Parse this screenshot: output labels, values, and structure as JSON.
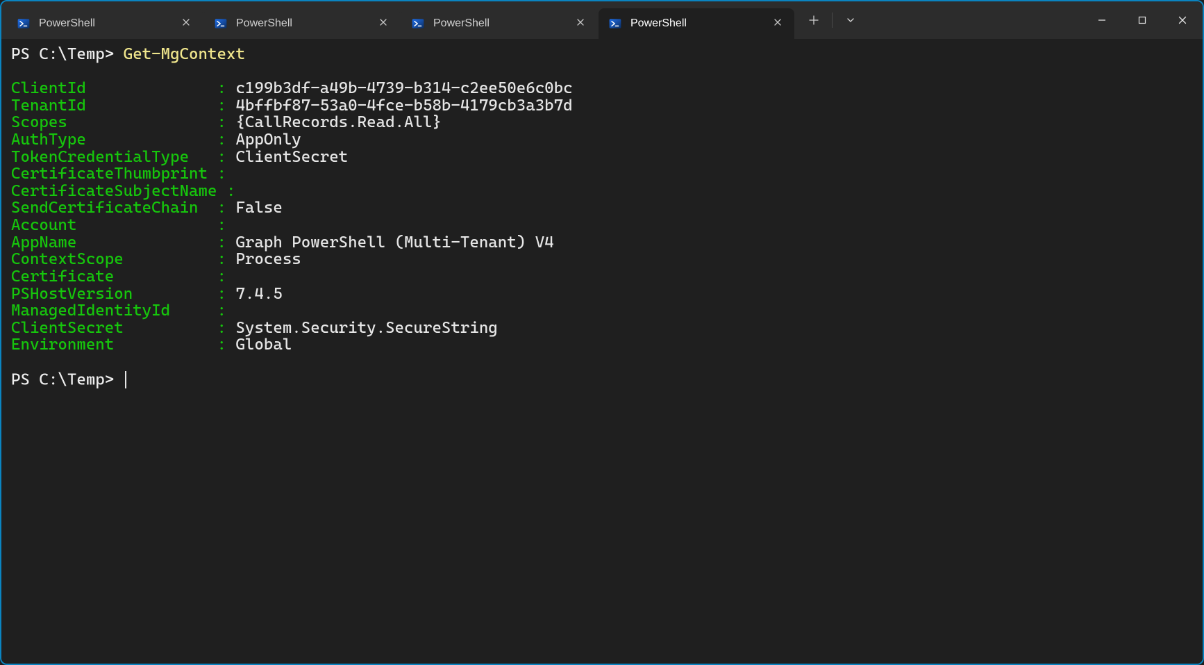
{
  "tabs": [
    {
      "title": "PowerShell",
      "active": false
    },
    {
      "title": "PowerShell",
      "active": false
    },
    {
      "title": "PowerShell",
      "active": false
    },
    {
      "title": "PowerShell",
      "active": true
    }
  ],
  "prompt": "PS C:\\Temp>",
  "command": "Get-MgContext",
  "output_keywidth": 22,
  "output": [
    {
      "name": "ClientId",
      "value": "c199b3df-a49b-4739-b314-c2ee50e6c0bc"
    },
    {
      "name": "TenantId",
      "value": "4bffbf87-53a0-4fce-b58b-4179cb3a3b7d"
    },
    {
      "name": "Scopes",
      "value": "{CallRecords.Read.All}"
    },
    {
      "name": "AuthType",
      "value": "AppOnly"
    },
    {
      "name": "TokenCredentialType",
      "value": "ClientSecret"
    },
    {
      "name": "CertificateThumbprint",
      "value": ""
    },
    {
      "name": "CertificateSubjectName",
      "value": ""
    },
    {
      "name": "SendCertificateChain",
      "value": "False"
    },
    {
      "name": "Account",
      "value": ""
    },
    {
      "name": "AppName",
      "value": "Graph PowerShell (Multi-Tenant) V4"
    },
    {
      "name": "ContextScope",
      "value": "Process"
    },
    {
      "name": "Certificate",
      "value": ""
    },
    {
      "name": "PSHostVersion",
      "value": "7.4.5"
    },
    {
      "name": "ManagedIdentityId",
      "value": ""
    },
    {
      "name": "ClientSecret",
      "value": "System.Security.SecureString"
    },
    {
      "name": "Environment",
      "value": "Global"
    }
  ],
  "prompt2": "PS C:\\Temp>"
}
